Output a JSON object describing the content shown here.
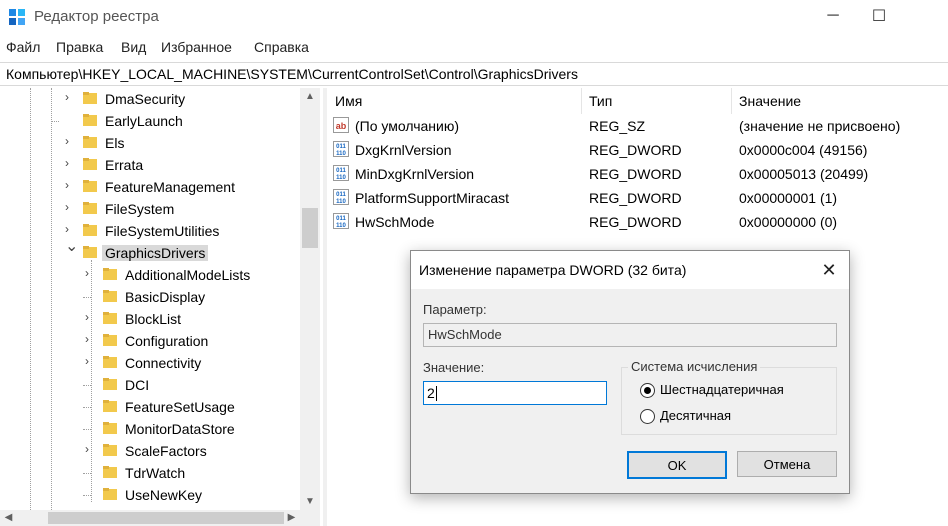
{
  "window": {
    "title": "Редактор реестра",
    "controls": {
      "minimize": "─",
      "maximize": "☐"
    }
  },
  "menu": [
    "Файл",
    "Правка",
    "Вид",
    "Избранное",
    "Справка"
  ],
  "address": "Компьютер\\HKEY_LOCAL_MACHINE\\SYSTEM\\CurrentControlSet\\Control\\GraphicsDrivers",
  "tree": {
    "items": [
      {
        "label": "DmaSecurity",
        "expandable": true
      },
      {
        "label": "EarlyLaunch",
        "expandable": false
      },
      {
        "label": "Els",
        "expandable": true
      },
      {
        "label": "Errata",
        "expandable": true
      },
      {
        "label": "FeatureManagement",
        "expandable": true
      },
      {
        "label": "FileSystem",
        "expandable": true
      },
      {
        "label": "FileSystemUtilities",
        "expandable": true
      },
      {
        "label": "GraphicsDrivers",
        "expandable": true,
        "expanded": true,
        "selected": true
      },
      {
        "label": "AdditionalModeLists",
        "expandable": true,
        "child": true
      },
      {
        "label": "BasicDisplay",
        "expandable": false,
        "child": true
      },
      {
        "label": "BlockList",
        "expandable": true,
        "child": true
      },
      {
        "label": "Configuration",
        "expandable": true,
        "child": true
      },
      {
        "label": "Connectivity",
        "expandable": true,
        "child": true
      },
      {
        "label": "DCI",
        "expandable": false,
        "child": true
      },
      {
        "label": "FeatureSetUsage",
        "expandable": false,
        "child": true
      },
      {
        "label": "MonitorDataStore",
        "expandable": false,
        "child": true
      },
      {
        "label": "ScaleFactors",
        "expandable": true,
        "child": true
      },
      {
        "label": "TdrWatch",
        "expandable": false,
        "child": true
      },
      {
        "label": "UseNewKey",
        "expandable": false,
        "child": true
      }
    ]
  },
  "list": {
    "headers": {
      "name": "Имя",
      "type": "Тип",
      "value": "Значение"
    },
    "rows": [
      {
        "icon": "string-value-icon",
        "name": "(По умолчанию)",
        "type": "REG_SZ",
        "value": "(значение не присвоено)"
      },
      {
        "icon": "binary-value-icon",
        "name": "DxgKrnlVersion",
        "type": "REG_DWORD",
        "value": "0x0000c004 (49156)"
      },
      {
        "icon": "binary-value-icon",
        "name": "MinDxgKrnlVersion",
        "type": "REG_DWORD",
        "value": "0x00005013 (20499)"
      },
      {
        "icon": "binary-value-icon",
        "name": "PlatformSupportMiracast",
        "type": "REG_DWORD",
        "value": "0x00000001 (1)"
      },
      {
        "icon": "binary-value-icon",
        "name": "HwSchMode",
        "type": "REG_DWORD",
        "value": "0x00000000 (0)"
      }
    ]
  },
  "dialog": {
    "title": "Изменение параметра DWORD (32 бита)",
    "param_label": "Параметр:",
    "param_value": "HwSchMode",
    "value_label": "Значение:",
    "value_input": "2",
    "base_group_label": "Система исчисления",
    "radio_hex": "Шестнадцатеричная",
    "radio_dec": "Десятичная",
    "selected_base": "hex",
    "ok": "OK",
    "cancel": "Отмена"
  },
  "colors": {
    "folder": "#f2c94c",
    "accent": "#0078d7",
    "selection": "#d9d9d9"
  }
}
